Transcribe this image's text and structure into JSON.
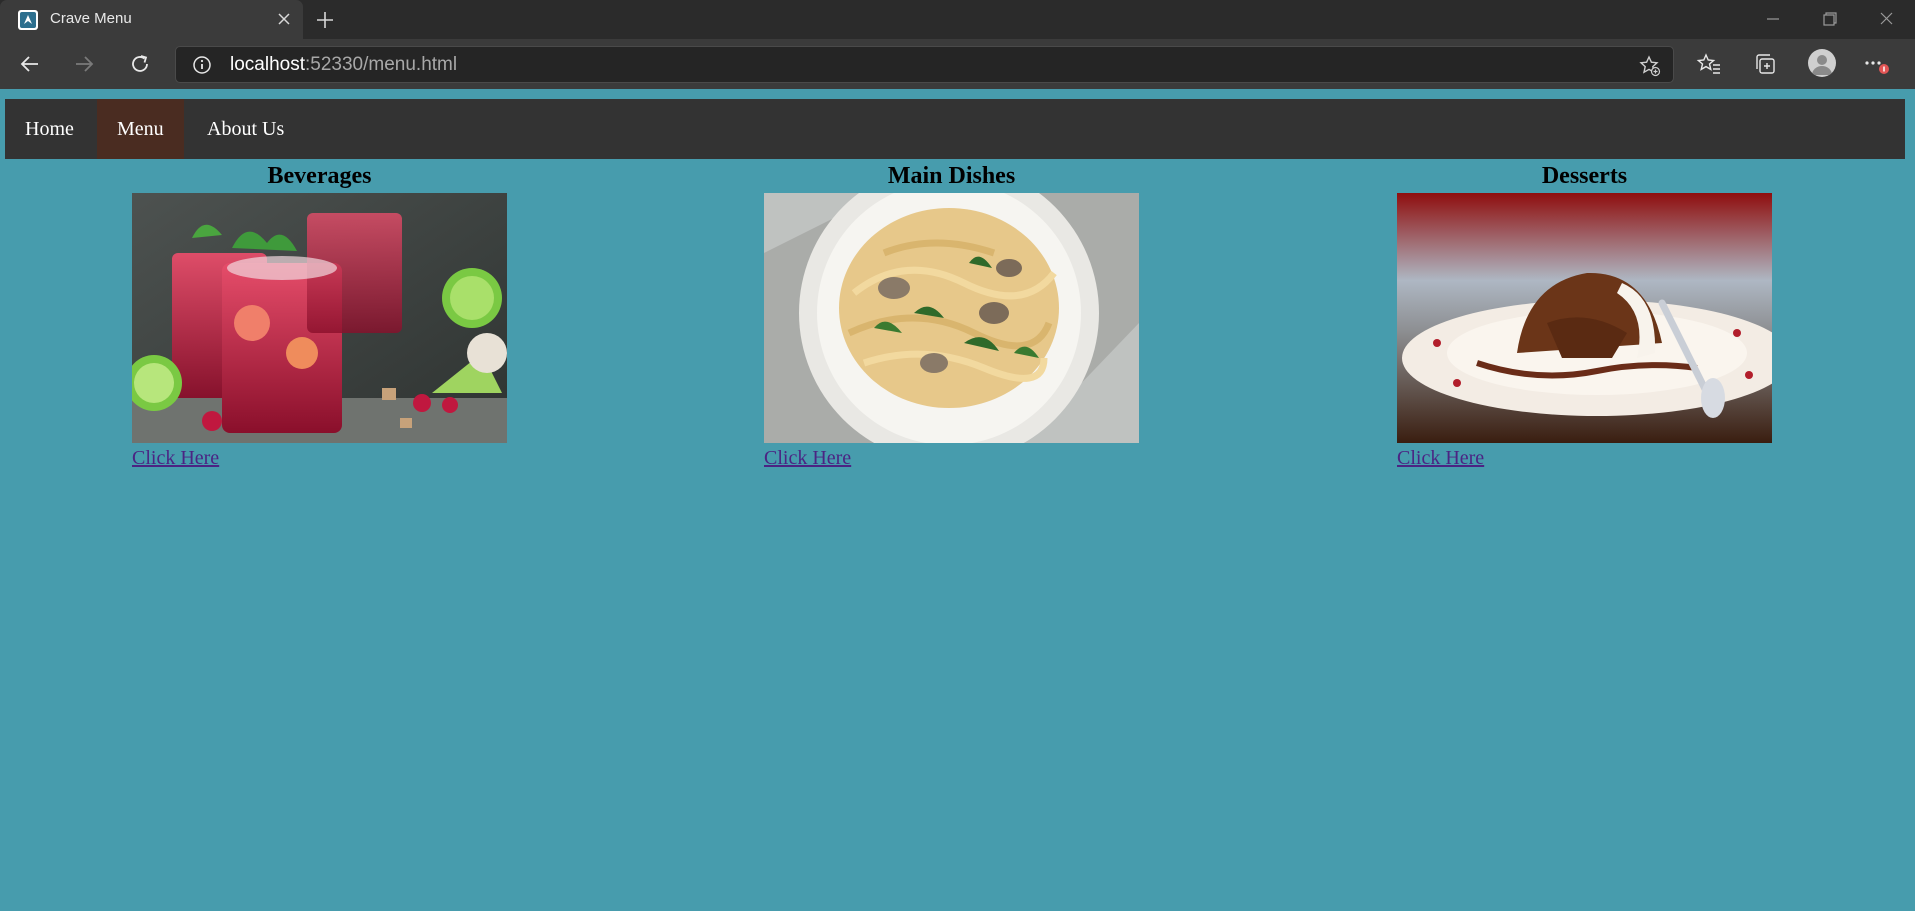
{
  "browser": {
    "tab_title": "Crave Menu",
    "url_host": "localhost",
    "url_rest": ":52330/menu.html"
  },
  "nav": {
    "home": "Home",
    "menu": "Menu",
    "about": "About Us"
  },
  "categories": [
    {
      "title": "Beverages",
      "link": "Click Here"
    },
    {
      "title": "Main Dishes",
      "link": "Click Here"
    },
    {
      "title": "Desserts",
      "link": "Click Here"
    }
  ],
  "colors": {
    "page_bg": "#479cad",
    "navbar_bg": "#333333",
    "nav_active_bg": "#4a2c21",
    "link": "#4b2483"
  }
}
